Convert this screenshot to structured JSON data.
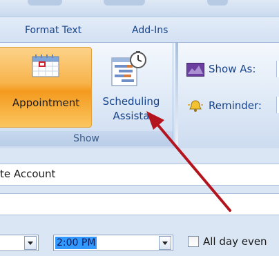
{
  "ribbon": {
    "tabs": [
      {
        "label": "Format Text"
      },
      {
        "label": "Add-Ins"
      }
    ],
    "show_group": {
      "label": "Show",
      "appointment_label": "Appointment",
      "scheduling_label_line1": "Scheduling",
      "scheduling_label_line2": "Assista"
    },
    "options": {
      "show_as_label": "Show As:",
      "reminder_label": "Reminder:"
    }
  },
  "form": {
    "account_text": "te Account",
    "end_time": "2:00 PM",
    "all_day_label": "All day even",
    "all_day_checked": false
  },
  "annotation": {
    "arrow_color": "#b3141e"
  },
  "colors": {
    "active_button": "#f8b34b",
    "ribbon_text": "#15428b",
    "time_highlight": "#3399ff"
  }
}
